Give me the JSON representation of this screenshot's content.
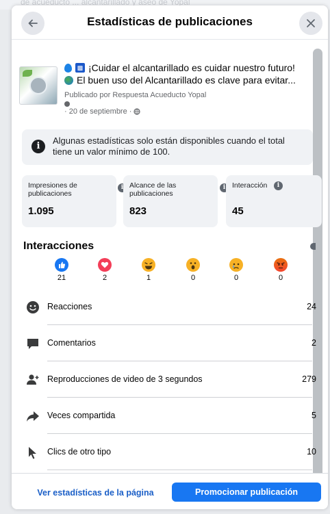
{
  "background": {
    "text": "de acueducto ... alcantarillado y aseo de Yopal"
  },
  "header": {
    "title": "Estadísticas de publicaciones",
    "back_icon": "arrow-left-icon",
    "close_icon": "close-icon"
  },
  "post": {
    "line1": "¡Cuidar el alcantarillado es cuidar nuestro futuro!",
    "line2": "El buen uso del Alcantarillado es clave para evitar...",
    "published_by": "Publicado por Respuesta Acueducto Yopal",
    "date": "· 20 de septiembre ·"
  },
  "notice": {
    "text": "Algunas estadísticas solo están disponibles cuando el total tiene un valor mínimo de 100."
  },
  "stats": [
    {
      "label": "Impresiones de publicaciones",
      "value": "1.095"
    },
    {
      "label": "Alcance de las publicaciones",
      "value": "823"
    },
    {
      "label": "Interacción",
      "value": "45"
    }
  ],
  "interactions": {
    "title": "Interacciones",
    "reactions": [
      {
        "name": "like",
        "count": "21",
        "color": "#1877f2"
      },
      {
        "name": "love",
        "count": "2",
        "color": "#f33e58"
      },
      {
        "name": "haha",
        "count": "1",
        "color": "#f7b125"
      },
      {
        "name": "wow",
        "count": "0",
        "color": "#f7b125"
      },
      {
        "name": "sad",
        "count": "0",
        "color": "#f7b125"
      },
      {
        "name": "angry",
        "count": "0",
        "color": "#e9710f"
      }
    ],
    "rows": [
      {
        "label": "Reacciones",
        "value": "24",
        "icon": "smiley-icon"
      },
      {
        "label": "Comentarios",
        "value": "2",
        "icon": "comment-icon"
      },
      {
        "label": "Reproducciones de video de 3 segundos",
        "value": "279",
        "icon": "person-add-icon"
      },
      {
        "label": "Veces compartida",
        "value": "5",
        "icon": "share-arrow-icon"
      },
      {
        "label": "Clics de otro tipo",
        "value": "10",
        "icon": "cursor-icon"
      }
    ]
  },
  "footer": {
    "link": "Ver estadísticas de la página",
    "button": "Promocionar publicación"
  }
}
